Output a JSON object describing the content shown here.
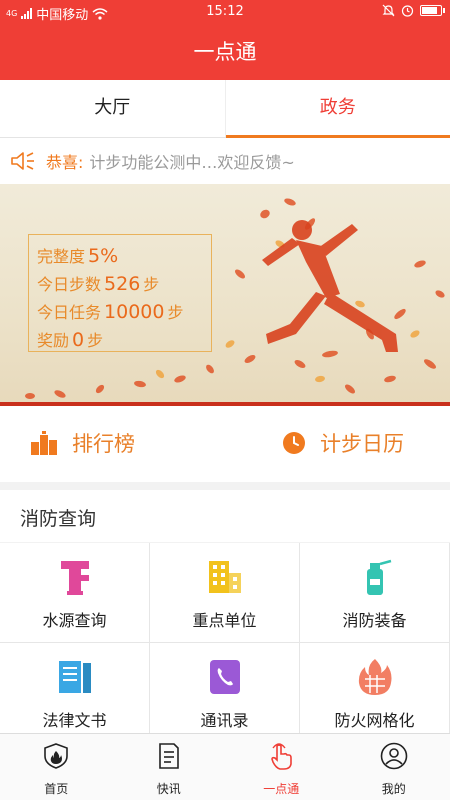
{
  "statusbar": {
    "network": "4G",
    "carrier": "中国移动",
    "time": "15:12",
    "icons": [
      "signal-icon",
      "wifi-icon",
      "mute-icon",
      "alarm-icon",
      "battery-icon"
    ]
  },
  "header": {
    "title": "一点通"
  },
  "tabs": [
    {
      "label": "大厅",
      "active": false
    },
    {
      "label": "政务",
      "active": true
    }
  ],
  "notice": {
    "icon": "speaker-icon",
    "lead": "恭喜:",
    "text": "计步功能公测中…欢迎反馈~"
  },
  "banner": {
    "completion_label": "完整度",
    "completion_value": "5%",
    "steps_label": "今日步数",
    "steps_value": "526",
    "steps_unit": "步",
    "task_label": "今日任务",
    "task_value": "10000",
    "task_unit": "步",
    "reward_label": "奖励",
    "reward_value": "0",
    "reward_unit": "步"
  },
  "quick": {
    "ranking_label": "排行榜",
    "ranking_icon": "podium-icon",
    "calendar_label": "计步日历",
    "calendar_icon": "clock-icon"
  },
  "section": {
    "title": "消防查询"
  },
  "grid": [
    {
      "label": "水源查询",
      "icon": "hydrant-icon",
      "color": "#e0489a"
    },
    {
      "label": "重点单位",
      "icon": "building-icon",
      "color": "#f2c21c"
    },
    {
      "label": "消防装备",
      "icon": "extinguisher-icon",
      "color": "#34c4b2"
    },
    {
      "label": "法律文书",
      "icon": "books-icon",
      "color": "#3aa7e4"
    },
    {
      "label": "通讯录",
      "icon": "phone-book-icon",
      "color": "#9b59d6"
    },
    {
      "label": "防火网格化",
      "icon": "fire-grid-icon",
      "color": "#f27e63"
    }
  ],
  "bottom_nav": [
    {
      "label": "首页",
      "icon": "shield-home-icon",
      "active": false
    },
    {
      "label": "快讯",
      "icon": "news-icon",
      "active": false
    },
    {
      "label": "一点通",
      "icon": "tap-hand-icon",
      "active": true
    },
    {
      "label": "我的",
      "icon": "user-icon",
      "active": false
    }
  ],
  "colors": {
    "primary": "#ef3e36",
    "accent": "#f07a1f",
    "text": "#222222"
  }
}
